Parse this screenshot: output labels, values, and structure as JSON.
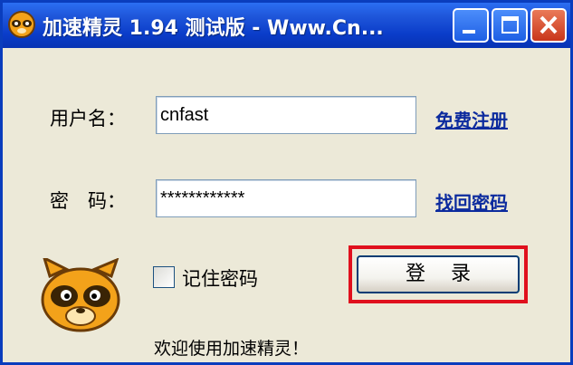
{
  "window": {
    "title": "加速精灵 1.94 测试版 - Www.Cn...",
    "buttons": [
      "minimize-icon",
      "maximize-icon",
      "close-icon"
    ]
  },
  "form": {
    "username_label": "用户名：",
    "username_value": "cnfast",
    "register_link": "免费注册",
    "password_label": "密　码：",
    "password_value": "************",
    "recover_link": "找回密码",
    "remember_label": "记住密码",
    "remember_checked": false,
    "login_button": "登录"
  },
  "footer": {
    "welcome": "欢迎使用加速精灵！"
  },
  "colors": {
    "titlebar": "#0a3cc9",
    "link": "#0c2b9e",
    "highlight": "#e0101d",
    "background": "#ece9d8"
  }
}
